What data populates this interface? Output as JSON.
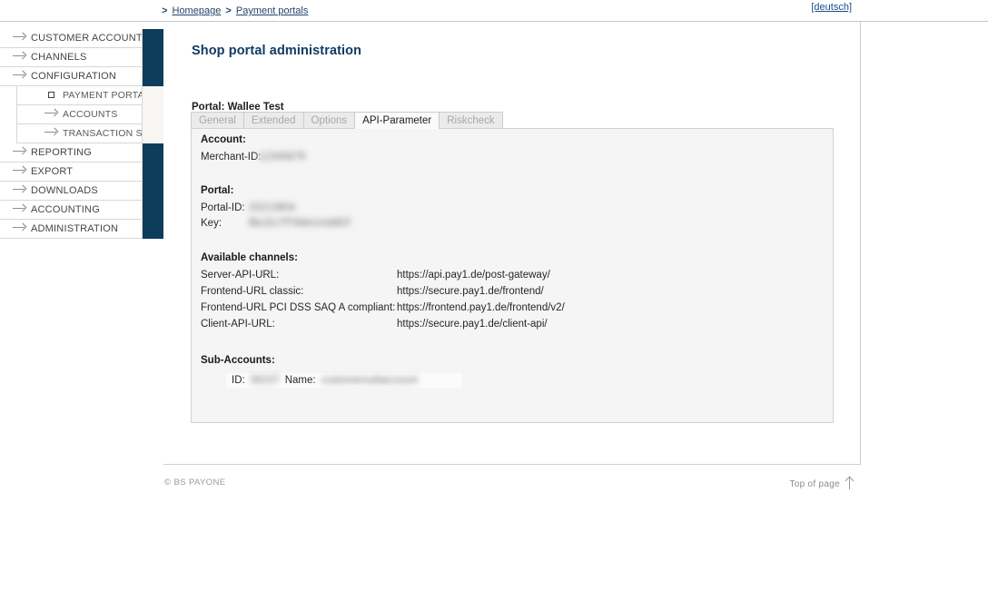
{
  "breadcrumb": {
    "leading_separator": ">",
    "separator": ">",
    "items": [
      {
        "label": "Homepage"
      },
      {
        "label": "Payment portals"
      }
    ]
  },
  "language_switch": {
    "label": "[deutsch]"
  },
  "sidebar": {
    "items": [
      {
        "label": "CUSTOMER ACCOUNTS",
        "icon": "arrow-right-icon",
        "block": "navy"
      },
      {
        "label": "CHANNELS",
        "icon": "arrow-right-icon",
        "block": "navy"
      },
      {
        "label": "CONFIGURATION",
        "icon": "arrow-right-icon",
        "block": "navy"
      },
      {
        "label": "PAYMENT PORTALS",
        "icon": "square-marker-icon",
        "block": "light",
        "sub": true,
        "active": true
      },
      {
        "label": "ACCOUNTS",
        "icon": "arrow-right-icon",
        "block": "light",
        "sub": true
      },
      {
        "label": "TRANSACTION STATUS",
        "icon": "arrow-right-icon",
        "block": "light",
        "sub": true
      },
      {
        "label": "REPORTING",
        "icon": "arrow-right-icon",
        "block": "navy"
      },
      {
        "label": "EXPORT",
        "icon": "arrow-right-icon",
        "block": "navy"
      },
      {
        "label": "DOWNLOADS",
        "icon": "arrow-right-icon",
        "block": "navy"
      },
      {
        "label": "ACCOUNTING",
        "icon": "arrow-right-icon",
        "block": "navy"
      },
      {
        "label": "ADMINISTRATION",
        "icon": "arrow-right-icon",
        "block": "navy"
      }
    ]
  },
  "main": {
    "title": "Shop portal administration",
    "portal_line": "Portal: Wallee Test",
    "tabs": [
      {
        "label": "General",
        "active": false
      },
      {
        "label": "Extended",
        "active": false
      },
      {
        "label": "Options",
        "active": false
      },
      {
        "label": "API-Parameter",
        "active": true
      },
      {
        "label": "Riskcheck",
        "active": false
      }
    ],
    "account": {
      "heading": "Account:",
      "merchant_id_label": "Merchant-ID:",
      "merchant_id_value": "12345678"
    },
    "portal": {
      "heading": "Portal:",
      "portal_id_label": "Portal-ID:",
      "portal_id_value": "20213804",
      "key_label": "Key:",
      "key_value": "BbJZc7fT6MnUcb8EF"
    },
    "channels": {
      "heading": "Available channels:",
      "rows": [
        {
          "label": "Server-API-URL:",
          "value": "https://api.pay1.de/post-gateway/"
        },
        {
          "label": "Frontend-URL classic:",
          "value": "https://secure.pay1.de/frontend/"
        },
        {
          "label": "Frontend-URL PCI DSS SAQ A compliant:",
          "value": "https://frontend.pay1.de/frontend/v2/"
        },
        {
          "label": "Client-API-URL:",
          "value": "https://secure.pay1.de/client-api/"
        }
      ]
    },
    "subaccounts": {
      "heading": "Sub-Accounts:",
      "id_label": "ID:",
      "id_value": "56107",
      "name_label": "Name:",
      "name_value": "customersubaccount"
    }
  },
  "footer": {
    "copyright": "© BS PAYONE",
    "top_of_page": "Top of page"
  },
  "colors": {
    "navy_block": "#0e3d5c",
    "heading": "#123a63",
    "link": "#24456b",
    "panel_bg": "#f5f5f5",
    "tab_inactive_bg": "#ebebeb",
    "tab_active_bg": "#fafafa"
  }
}
